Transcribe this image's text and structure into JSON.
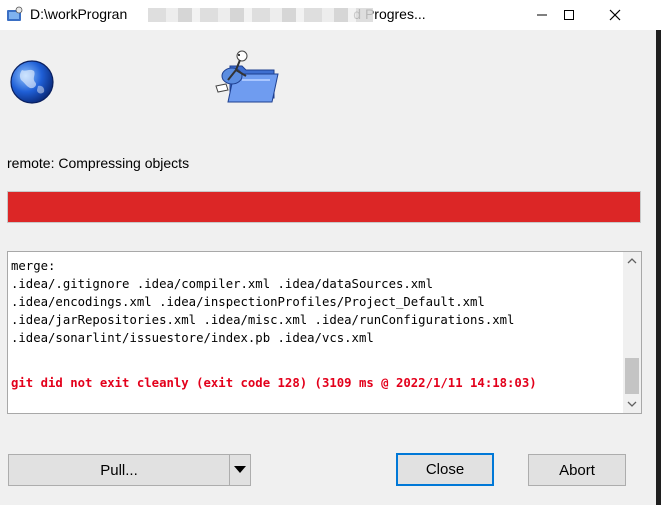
{
  "window": {
    "title_start": "D:\\workProgran",
    "title_end": "d Progres..."
  },
  "window_buttons": {
    "minimize": "—",
    "maximize": "☐",
    "close": "✕"
  },
  "status_text": "remote: Compressing objects",
  "progress": {
    "fraction": 1.0,
    "color": "#dc2626"
  },
  "log": {
    "lines": [
      "merge:",
      ".idea/.gitignore .idea/compiler.xml .idea/dataSources.xml",
      ".idea/encodings.xml .idea/inspectionProfiles/Project_Default.xml",
      ".idea/jarRepositories.xml .idea/misc.xml .idea/runConfigurations.xml",
      ".idea/sonarlint/issuestore/index.pb .idea/vcs.xml",
      "",
      ""
    ],
    "error": "git did not exit cleanly (exit code 128) (3109 ms @ 2022/1/11 14:18:03)",
    "error_color": "#e3001b"
  },
  "buttons": {
    "pull": "Pull...",
    "pull_dropdown": "▾",
    "close": "Close",
    "abort": "Abort"
  },
  "scrollbar": {
    "position": 0.9
  }
}
